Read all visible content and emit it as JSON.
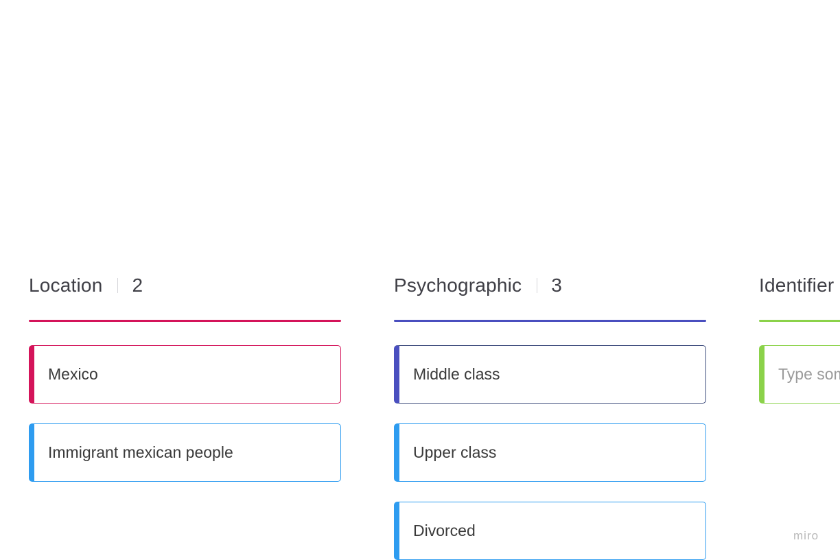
{
  "colors": {
    "location_accent": "#d4145a",
    "psychographic_accent": "#4a4fbf",
    "identifier_accent": "#8bd24a",
    "default_card_accent": "#2e9cf0",
    "middle_class_border": "#3b4a7a"
  },
  "columns": [
    {
      "title": "Location",
      "count": "2",
      "cards": [
        "Mexico",
        "Immigrant mexican people"
      ]
    },
    {
      "title": "Psychographic",
      "count": "3",
      "cards": [
        "Middle class",
        "Upper class",
        "Divorced"
      ]
    },
    {
      "title": "Identifier",
      "card_placeholder": "Type som"
    }
  ],
  "brand": {
    "logo_text": "miro"
  }
}
